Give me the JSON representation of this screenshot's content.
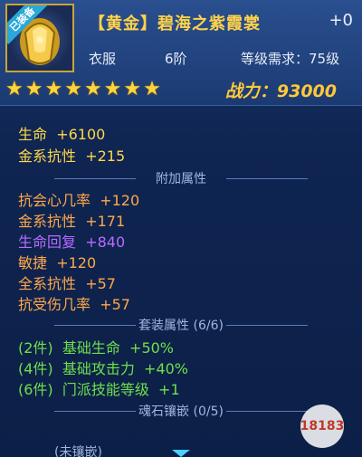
{
  "header": {
    "equip_tag": "已装备",
    "title": "【黄金】碧海之紫霞裳",
    "plus": "+0",
    "type": "衣服",
    "tier": "6阶",
    "level_req": "等级需求：75级",
    "stars": 8,
    "power": "战力：93000"
  },
  "base": [
    {
      "label": "生命",
      "value": "+6100"
    },
    {
      "label": "金系抗性",
      "value": "+215"
    }
  ],
  "extra_title": "附加属性",
  "extra": [
    {
      "label": "抗会心几率",
      "value": "+120",
      "color": "orange"
    },
    {
      "label": "金系抗性",
      "value": "+171",
      "color": "orange"
    },
    {
      "label": "生命回复",
      "value": "+840",
      "color": "purple"
    },
    {
      "label": "敏捷",
      "value": "+120",
      "color": "orange"
    },
    {
      "label": "全系抗性",
      "value": "+57",
      "color": "orange"
    },
    {
      "label": "抗受伤几率",
      "value": "+57",
      "color": "orange"
    }
  ],
  "set_title": "套装属性 (6/6)",
  "set": [
    {
      "pieces": "(2件)",
      "label": "基础生命",
      "value": "+50%"
    },
    {
      "pieces": "(4件)",
      "label": "基础攻击力",
      "value": "+40%"
    },
    {
      "pieces": "(6件)",
      "label": "门派技能等级",
      "value": "+1"
    }
  ],
  "soul_title": "魂石镶嵌 (0/5)",
  "partial_text": "(未镶嵌)",
  "watermark": "18183",
  "colors": {
    "gold": "#ffd84a",
    "orange": "#ffa84a",
    "purple": "#b86bff",
    "green": "#6fe04a"
  }
}
